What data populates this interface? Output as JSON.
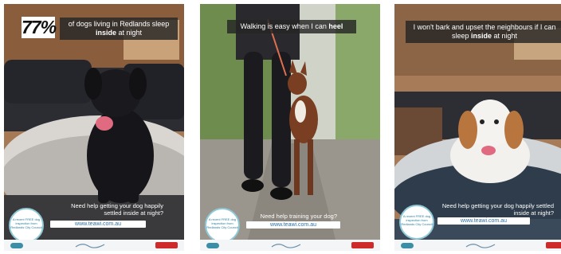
{
  "posters": [
    {
      "stat": "77%",
      "headline_pre": "of dogs living in Redlands sleep ",
      "headline_bold": "inside",
      "headline_post": " at night",
      "cta": "Need help getting your dog happily settled inside at night?",
      "url": "www.teawi.com.au",
      "badge": "A recent FREE dog inspection from Redlands City Council"
    },
    {
      "headline_pre": "Walking is easy when I can ",
      "headline_bold": "heel",
      "headline_post": "",
      "cta": "Need help training your dog?",
      "url": "www.teawi.com.au",
      "badge": "A recent FREE dog inspection from Redlands City Council"
    },
    {
      "headline_pre": "I won't bark and upset the neighbours if I can sleep ",
      "headline_bold": "inside",
      "headline_post": " at night",
      "cta": "Need help getting your dog happily settled inside at night?",
      "url": "www.teawi.com.au",
      "badge": "A recent FREE dog inspection from Redlands City Council"
    }
  ],
  "colors": {
    "banner": "#262626",
    "url_text": "#2a6fa8",
    "badge_ring": "#8fc9d8",
    "logo_red": "#cf2a2a",
    "logo_teal": "#3a8fa6"
  },
  "icons": [
    "dog-bed-photo",
    "dog-walking-photo",
    "spaniel-bed-photo",
    "council-logo",
    "sponsor-logo"
  ]
}
